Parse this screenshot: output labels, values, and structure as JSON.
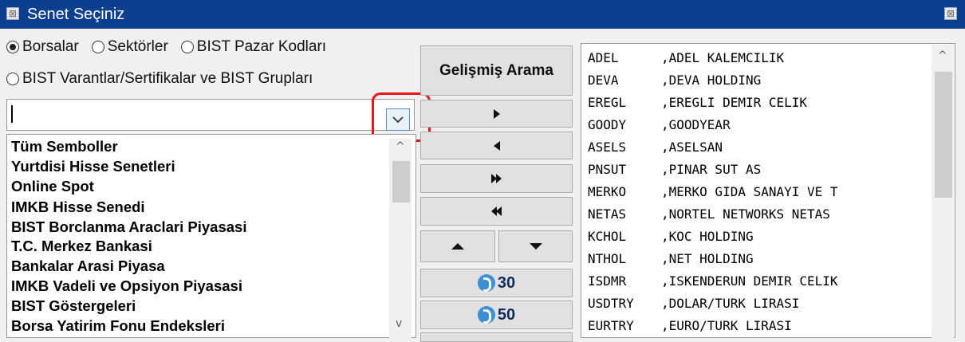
{
  "window": {
    "title": "Senet Seçiniz",
    "title_icon": "window-menu-icon",
    "close_icon": "close-icon"
  },
  "source_radios": [
    {
      "label": "Borsalar",
      "checked": true
    },
    {
      "label": "Sektörler",
      "checked": false
    },
    {
      "label": "BIST Pazar Kodları",
      "checked": false
    },
    {
      "label": "BIST Varantlar/Sertifikalar ve BIST Grupları",
      "checked": false
    }
  ],
  "search": {
    "value": "",
    "dropdown_icon": "chevron-down-icon"
  },
  "market_list": {
    "items": [
      "Tüm Semboller",
      "Yurtdisi Hisse Senetleri",
      "Online Spot",
      "IMKB Hisse Senedi",
      "BIST Borclanma Araclari Piyasasi",
      "T.C. Merkez Bankasi",
      "Bankalar Arasi Piyasa",
      "IMKB Vadeli ve Opsiyon Piyasasi",
      "BIST Göstergeleri",
      "Borsa Yatirim Fonu Endeksleri"
    ]
  },
  "actions": {
    "advanced_search": "Gelişmiş Arama",
    "add_icon": "play-right-icon",
    "remove_icon": "play-left-icon",
    "add_all_icon": "fast-forward-icon",
    "remove_all_icon": "rewind-icon",
    "move_up_icon": "triangle-up-icon",
    "move_down_icon": "triangle-down-icon",
    "top30_label": "30",
    "top50_label": "50",
    "brand_icon": "brand-logo-icon"
  },
  "selected_symbols": [
    {
      "code": "ADEL",
      "name": ",ADEL KALEMCILIK"
    },
    {
      "code": "DEVA",
      "name": ",DEVA HOLDING"
    },
    {
      "code": "EREGL",
      "name": ",EREGLI DEMIR CELIK"
    },
    {
      "code": "GOODY",
      "name": ",GOODYEAR"
    },
    {
      "code": "ASELS",
      "name": ",ASELSAN"
    },
    {
      "code": "PNSUT",
      "name": ",PINAR SUT AS"
    },
    {
      "code": "MERKO",
      "name": ",MERKO GIDA SANAYI VE T"
    },
    {
      "code": "NETAS",
      "name": ",NORTEL NETWORKS NETAS"
    },
    {
      "code": "KCHOL",
      "name": ",KOC HOLDING"
    },
    {
      "code": "NTHOL",
      "name": ",NET HOLDING"
    },
    {
      "code": "ISDMR",
      "name": ",ISKENDERUN DEMIR CELIK"
    },
    {
      "code": "USDTRY",
      "name": ",DOLAR/TURK LIRASI"
    },
    {
      "code": "EURTRY",
      "name": ",EURO/TURK LIRASI"
    }
  ],
  "colors": {
    "titlebar": "#0d3f8f",
    "highlight": "#e8161a",
    "logo": "#3d8fd6"
  }
}
